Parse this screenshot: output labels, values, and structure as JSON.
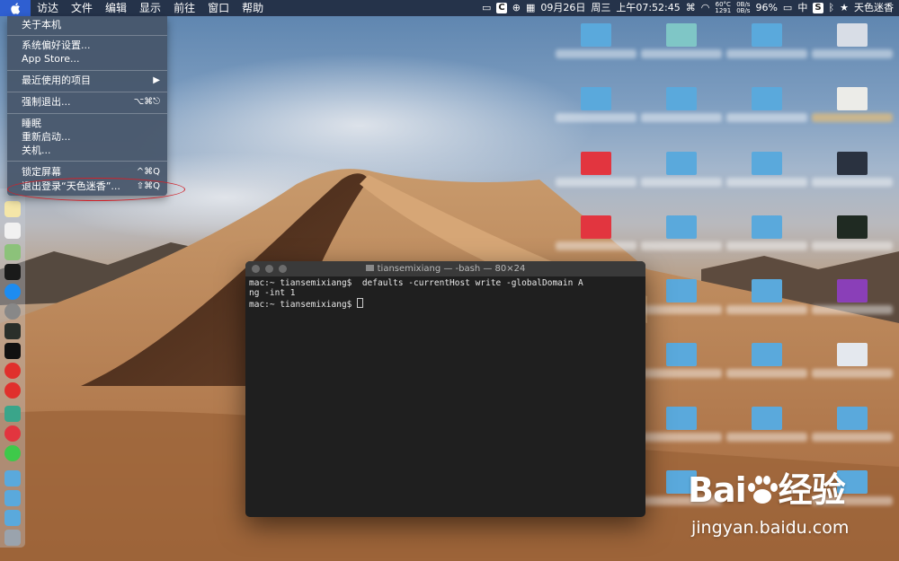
{
  "menubar": {
    "items": [
      "访达",
      "文件",
      "编辑",
      "显示",
      "前往",
      "窗口",
      "帮助"
    ],
    "status": {
      "date": "09月26日",
      "weekday": "周三",
      "time": "上午07:52:45",
      "temp": "60°C",
      "fan": "1291",
      "net_up": "0B/s",
      "net_down": "0B/s",
      "battery": "96%",
      "ime": "中",
      "ime_app": "S",
      "user": "天色迷香"
    }
  },
  "apple_menu": {
    "about": "关于本机",
    "prefs": "系统偏好设置...",
    "store": "App Store...",
    "recent": "最近使用的项目",
    "recent_arrow": "▶",
    "force_quit": "强制退出...",
    "force_quit_sc": "⌥⌘⎋",
    "sleep": "睡眠",
    "restart": "重新启动...",
    "shutdown": "关机...",
    "lock": "锁定屏幕",
    "lock_sc": "^⌘Q",
    "logout": "退出登录“天色迷香”...",
    "logout_sc": "⇧⌘Q"
  },
  "terminal": {
    "title": "tiansemixiang — -bash — 80×24",
    "line1": "mac:~ tiansemixiang$  defaults -currentHost write -globalDomain A",
    "line2": "ng -int 1",
    "line3": "mac:~ tiansemixiang$ "
  },
  "watermark": {
    "logo": "Bai",
    "logo_cn": "经验",
    "url": "jingyan.baidu.com"
  },
  "colors": {
    "menubar_bg": "#1e283c",
    "highlight": "#2f5fd1",
    "annotation_ring": "#d0222a",
    "folder": "#5aa9dc",
    "red_folder": "#e2353f"
  }
}
